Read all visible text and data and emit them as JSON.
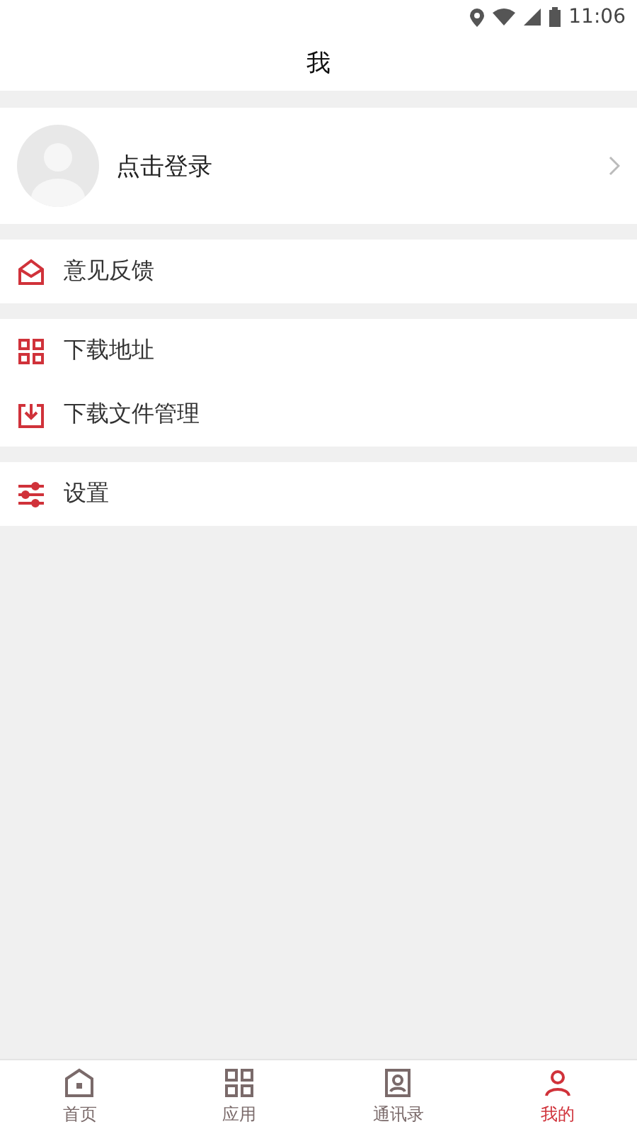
{
  "status_bar": {
    "time": "11:06"
  },
  "header": {
    "title": "我"
  },
  "profile": {
    "login_label": "点击登录"
  },
  "menu_groups": [
    {
      "items": [
        {
          "kind": "feedback",
          "label": "意见反馈"
        }
      ]
    },
    {
      "items": [
        {
          "kind": "qrcode",
          "label": "下载地址"
        },
        {
          "kind": "download",
          "label": "下载文件管理"
        }
      ]
    },
    {
      "items": [
        {
          "kind": "settings",
          "label": "设置"
        }
      ]
    }
  ],
  "tab_bar": [
    {
      "kind": "home",
      "label": "首页",
      "selected": false
    },
    {
      "kind": "apps",
      "label": "应用",
      "selected": false
    },
    {
      "kind": "contacts",
      "label": "通讯录",
      "selected": false
    },
    {
      "kind": "me",
      "label": "我的",
      "selected": true
    }
  ]
}
